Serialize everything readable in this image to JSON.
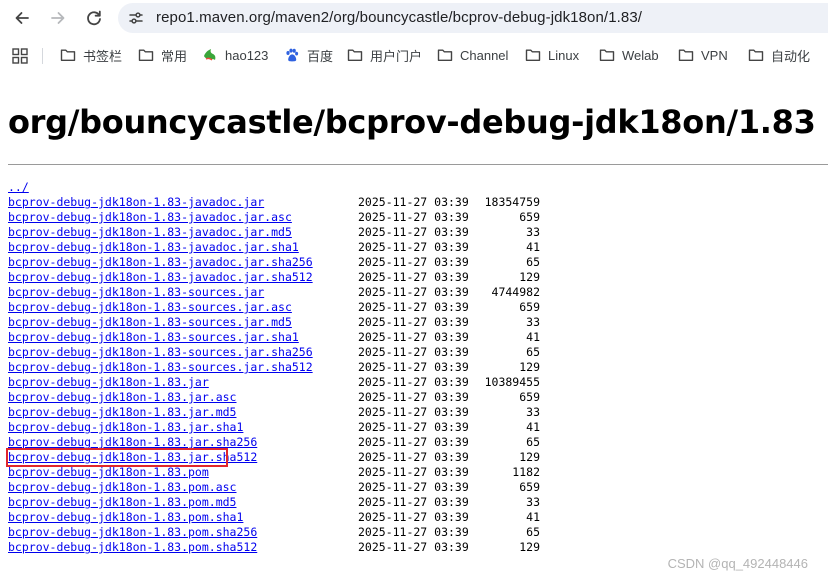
{
  "browser": {
    "url": "repo1.maven.org/maven2/org/bouncycastle/bcprov-debug-jdk18on/1.83/",
    "nav": {
      "back": "back-arrow-icon",
      "forward": "forward-arrow-icon",
      "reload": "reload-icon",
      "site_info": "site-info-icon"
    }
  },
  "bookmarks": [
    {
      "label": "书签栏",
      "icon": "folder-icon"
    },
    {
      "label": "常用",
      "icon": "folder-icon"
    },
    {
      "label": "hao123",
      "icon": "hao123-icon"
    },
    {
      "label": "百度",
      "icon": "baidu-paw-icon"
    },
    {
      "label": "用户门户",
      "icon": "folder-icon"
    },
    {
      "label": "Channel",
      "icon": "folder-icon"
    },
    {
      "label": "Linux",
      "icon": "folder-icon"
    },
    {
      "label": "Welab",
      "icon": "folder-icon"
    },
    {
      "label": "VPN",
      "icon": "folder-icon"
    },
    {
      "label": "自动化",
      "icon": "folder-icon"
    }
  ],
  "page": {
    "heading": "org/bouncycastle/bcprov-debug-jdk18on/1.83",
    "parent_link": "../",
    "files": [
      {
        "name": "bcprov-debug-jdk18on-1.83-javadoc.jar",
        "date": "2025-11-27 03:39",
        "size": "18354759"
      },
      {
        "name": "bcprov-debug-jdk18on-1.83-javadoc.jar.asc",
        "date": "2025-11-27 03:39",
        "size": "659"
      },
      {
        "name": "bcprov-debug-jdk18on-1.83-javadoc.jar.md5",
        "date": "2025-11-27 03:39",
        "size": "33"
      },
      {
        "name": "bcprov-debug-jdk18on-1.83-javadoc.jar.sha1",
        "date": "2025-11-27 03:39",
        "size": "41"
      },
      {
        "name": "bcprov-debug-jdk18on-1.83-javadoc.jar.sha256",
        "date": "2025-11-27 03:39",
        "size": "65"
      },
      {
        "name": "bcprov-debug-jdk18on-1.83-javadoc.jar.sha512",
        "date": "2025-11-27 03:39",
        "size": "129"
      },
      {
        "name": "bcprov-debug-jdk18on-1.83-sources.jar",
        "date": "2025-11-27 03:39",
        "size": "4744982"
      },
      {
        "name": "bcprov-debug-jdk18on-1.83-sources.jar.asc",
        "date": "2025-11-27 03:39",
        "size": "659"
      },
      {
        "name": "bcprov-debug-jdk18on-1.83-sources.jar.md5",
        "date": "2025-11-27 03:39",
        "size": "33"
      },
      {
        "name": "bcprov-debug-jdk18on-1.83-sources.jar.sha1",
        "date": "2025-11-27 03:39",
        "size": "41"
      },
      {
        "name": "bcprov-debug-jdk18on-1.83-sources.jar.sha256",
        "date": "2025-11-27 03:39",
        "size": "65"
      },
      {
        "name": "bcprov-debug-jdk18on-1.83-sources.jar.sha512",
        "date": "2025-11-27 03:39",
        "size": "129"
      },
      {
        "name": "bcprov-debug-jdk18on-1.83.jar",
        "date": "2025-11-27 03:39",
        "size": "10389455"
      },
      {
        "name": "bcprov-debug-jdk18on-1.83.jar.asc",
        "date": "2025-11-27 03:39",
        "size": "659"
      },
      {
        "name": "bcprov-debug-jdk18on-1.83.jar.md5",
        "date": "2025-11-27 03:39",
        "size": "33"
      },
      {
        "name": "bcprov-debug-jdk18on-1.83.jar.sha1",
        "date": "2025-11-27 03:39",
        "size": "41"
      },
      {
        "name": "bcprov-debug-jdk18on-1.83.jar.sha256",
        "date": "2025-11-27 03:39",
        "size": "65"
      },
      {
        "name": "bcprov-debug-jdk18on-1.83.jar.sha512",
        "date": "2025-11-27 03:39",
        "size": "129"
      },
      {
        "name": "bcprov-debug-jdk18on-1.83.pom",
        "date": "2025-11-27 03:39",
        "size": "1182"
      },
      {
        "name": "bcprov-debug-jdk18on-1.83.pom.asc",
        "date": "2025-11-27 03:39",
        "size": "659"
      },
      {
        "name": "bcprov-debug-jdk18on-1.83.pom.md5",
        "date": "2025-11-27 03:39",
        "size": "33"
      },
      {
        "name": "bcprov-debug-jdk18on-1.83.pom.sha1",
        "date": "2025-11-27 03:39",
        "size": "41"
      },
      {
        "name": "bcprov-debug-jdk18on-1.83.pom.sha256",
        "date": "2025-11-27 03:39",
        "size": "65"
      },
      {
        "name": "bcprov-debug-jdk18on-1.83.pom.sha512",
        "date": "2025-11-27 03:39",
        "size": "129"
      }
    ],
    "highlighted_file": "bcprov-debug-jdk18on-1.83.jar"
  },
  "watermark": "CSDN @qq_492448446",
  "colors": {
    "link": "#0000ee",
    "highlight": "#e0262c",
    "omnibox": "#eef1f7"
  }
}
